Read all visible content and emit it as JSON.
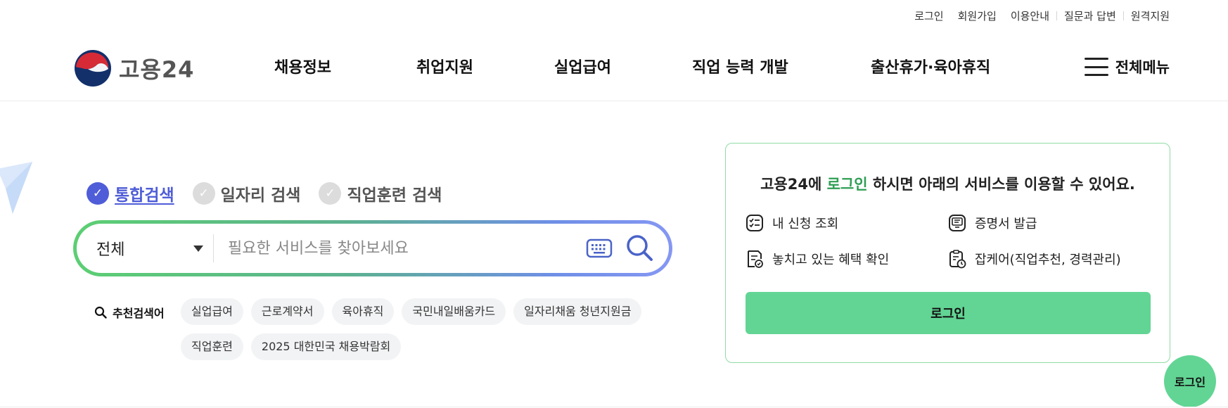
{
  "utility_nav": {
    "login": "로그인",
    "signup": "회원가입",
    "guide": "이용안내",
    "qna": "질문과 답변",
    "remote": "원격지원"
  },
  "logo": {
    "text": "고용24",
    "icon": "government-taegeuk-logo"
  },
  "gnb": {
    "items": [
      {
        "label": "채용정보"
      },
      {
        "label": "취업지원"
      },
      {
        "label": "실업급여"
      },
      {
        "label": "직업 능력 개발"
      },
      {
        "label": "출산휴가·육아휴직"
      }
    ],
    "all_menu_label": "전체메뉴"
  },
  "search": {
    "tabs": [
      {
        "label": "통합검색",
        "active": true
      },
      {
        "label": "일자리 검색",
        "active": false
      },
      {
        "label": "직업훈련 검색",
        "active": false
      }
    ],
    "scope_value": "전체",
    "placeholder": "필요한 서비스를 찾아보세요",
    "recommended_label": "추천검색어",
    "keywords": [
      "실업급여",
      "근로계약서",
      "육아휴직",
      "국민내일배움카드",
      "일자리채움 청년지원금",
      "직업훈련",
      "2025 대한민국 채용박람회"
    ]
  },
  "login_card": {
    "title_before": "고용24에 ",
    "title_highlight": "로그인",
    "title_after": " 하시면 아래의 서비스를 이용할 수 있어요.",
    "services": [
      {
        "label": "내 신청 조회",
        "icon": "checklist-icon"
      },
      {
        "label": "증명서 발급",
        "icon": "certificate-icon"
      },
      {
        "label": "놓치고 있는 혜택 확인",
        "icon": "benefit-check-icon"
      },
      {
        "label": "잡케어(직업추천, 경력관리)",
        "icon": "clipboard-clock-icon"
      }
    ],
    "button_label": "로그인"
  },
  "floating_login_label": "로그인",
  "colors": {
    "brand_green": "#62d594",
    "highlight_green": "#2f9e55",
    "active_blue": "#4f5dd8",
    "gradient_start": "#5ccf73",
    "gradient_end": "#8597f3"
  }
}
